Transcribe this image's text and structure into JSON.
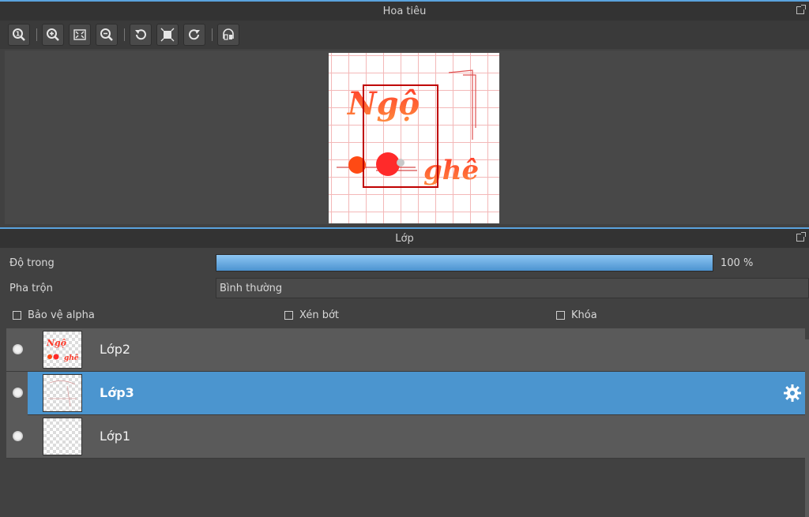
{
  "navigator": {
    "title": "Hoa tiêu",
    "toolbar": [
      {
        "icon": "zoom-actual-size-icon"
      },
      {
        "icon": "zoom-in-icon"
      },
      {
        "icon": "fit-screen-icon"
      },
      {
        "icon": "zoom-out-icon"
      },
      {
        "icon": "rotate-left-icon"
      },
      {
        "icon": "fit-canvas-icon"
      },
      {
        "icon": "rotate-right-icon"
      },
      {
        "icon": "flip-horizontal-icon"
      }
    ],
    "artwork_text": {
      "line1": "Ngộ",
      "line2": "ghê"
    }
  },
  "layer_panel": {
    "title": "Lớp",
    "opacity_label": "Độ trong",
    "opacity_value": 100,
    "opacity_text": "100 %",
    "blend_label": "Pha trộn",
    "blend_value": "Bình thường",
    "checkboxes": {
      "protect_alpha": "Bảo vệ alpha",
      "clipping": "Xén bớt",
      "lock": "Khóa"
    },
    "layers": [
      {
        "name": "Lớp2",
        "selected": false
      },
      {
        "name": "Lớp3",
        "selected": true
      },
      {
        "name": "Lớp1",
        "selected": false
      }
    ]
  },
  "colors": {
    "accent": "#4b95cf",
    "panel": "#414141"
  }
}
